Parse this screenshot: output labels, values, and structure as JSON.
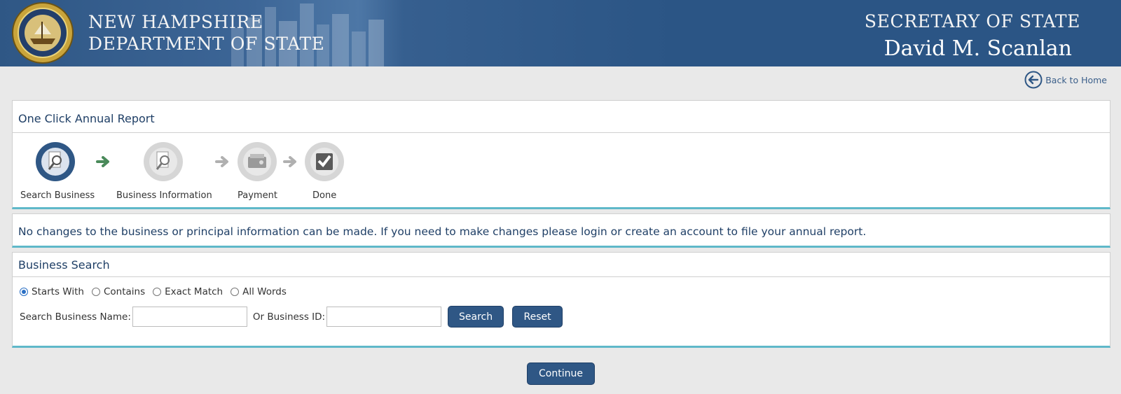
{
  "header": {
    "dept_line1": "NEW HAMPSHIRE",
    "dept_line2": "DEPARTMENT OF STATE",
    "sos_title": "SECRETARY OF STATE",
    "sos_name": "David M. Scanlan"
  },
  "nav": {
    "back_label": "Back to Home"
  },
  "wizard": {
    "title": "One Click Annual Report",
    "steps": [
      {
        "label": "Search Business",
        "status": "active"
      },
      {
        "label": "Business Information",
        "status": "pending"
      },
      {
        "label": "Payment",
        "status": "pending"
      },
      {
        "label": "Done",
        "status": "pending"
      }
    ]
  },
  "notice": {
    "text": "No changes to the business or principal information can be made. If you need to make changes please login or create an account to file your annual report."
  },
  "search": {
    "title": "Business Search",
    "options": [
      {
        "label": "Starts With",
        "selected": true
      },
      {
        "label": "Contains",
        "selected": false
      },
      {
        "label": "Exact Match",
        "selected": false
      },
      {
        "label": "All Words",
        "selected": false
      }
    ],
    "name_label": "Search Business Name:",
    "name_value": "",
    "id_label": "Or Business ID:",
    "id_value": "",
    "search_button": "Search",
    "reset_button": "Reset"
  },
  "footer": {
    "continue_button": "Continue"
  },
  "colors": {
    "brand": "#2f5785",
    "accent": "#5fb8c9",
    "active_step": "#2f5785",
    "arrow_active": "#4a8a5a",
    "arrow_inactive": "#b0b0b0"
  }
}
